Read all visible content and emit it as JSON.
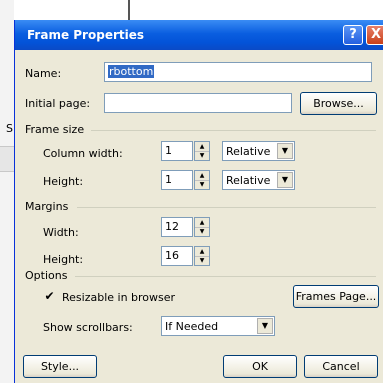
{
  "background": {
    "left_letter": "S"
  },
  "dialog": {
    "title": "Frame Properties",
    "help_label": "?",
    "close_label": "X",
    "name_label": "Name:",
    "name_value": "rbottom",
    "initial_page_label": "Initial page:",
    "initial_page_value": "",
    "browse_label": "Browse...",
    "frame_size": {
      "group_label": "Frame size",
      "column_width_label": "Column width:",
      "column_width_value": "1",
      "column_width_unit": "Relative",
      "height_label": "Height:",
      "height_value": "1",
      "height_unit": "Relative"
    },
    "margins": {
      "group_label": "Margins",
      "width_label": "Width:",
      "width_value": "12",
      "height_label": "Height:",
      "height_value": "16"
    },
    "options": {
      "group_label": "Options",
      "resizable_label": "Resizable in browser",
      "resizable_checked": true,
      "frames_page_label": "Frames Page...",
      "scrollbars_label": "Show scrollbars:",
      "scrollbars_value": "If Needed"
    },
    "style_label": "Style...",
    "ok_label": "OK",
    "cancel_label": "Cancel"
  },
  "icons": {
    "spin_up": "▲",
    "spin_down": "▼",
    "dropdown": "▼",
    "check": "✔"
  },
  "colors": {
    "title_bar": "#0a5ee0",
    "face": "#ece9d8",
    "selection": "#316ac5"
  }
}
